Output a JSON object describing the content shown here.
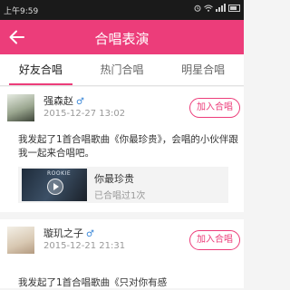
{
  "status_bar": {
    "time": "上午9:59"
  },
  "header": {
    "title": "合唱表演"
  },
  "tabs": [
    {
      "label": "好友合唱",
      "active": true
    },
    {
      "label": "热门合唱",
      "active": false
    },
    {
      "label": "明星合唱",
      "active": false
    }
  ],
  "posts": [
    {
      "username": "强森赵",
      "gender_icon": "♂",
      "time": "2015-12-27 13:02",
      "action_label": "加入合唱",
      "message": "我发起了1首合唱歌曲《你最珍贵》，会唱的小伙伴跟我一起来合唱吧。",
      "song": {
        "cover_text": "ROOKIE",
        "name": "你最珍贵",
        "count_text": "已合唱过1次"
      }
    },
    {
      "username": "璇玑之子",
      "gender_icon": "♂",
      "time": "2015-12-21 21:31",
      "action_label": "加入合唱",
      "message": "我发起了1首合唱歌曲《只对你有感"
    }
  ],
  "colors": {
    "accent": "#ec3d7a",
    "male": "#3a87d8"
  }
}
